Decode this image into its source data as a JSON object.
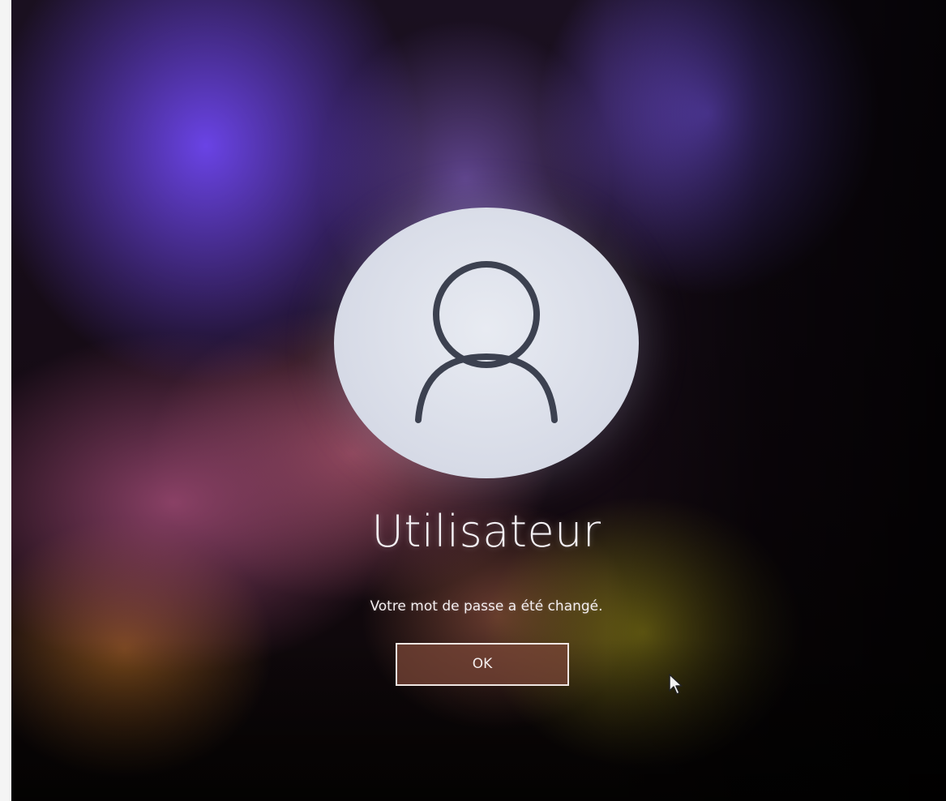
{
  "lock_screen": {
    "user_name": "Utilisateur",
    "message": "Votre mot de passe a été changé.",
    "ok_button_label": "OK"
  },
  "icons": {
    "avatar": "user-silhouette-icon",
    "pointer": "mouse-pointer-icon"
  },
  "colors": {
    "avatar_background": "#dfe2ec",
    "avatar_glyph": "#3c4150",
    "text": "#f3f0f4",
    "button_border": "#efe6e2"
  }
}
